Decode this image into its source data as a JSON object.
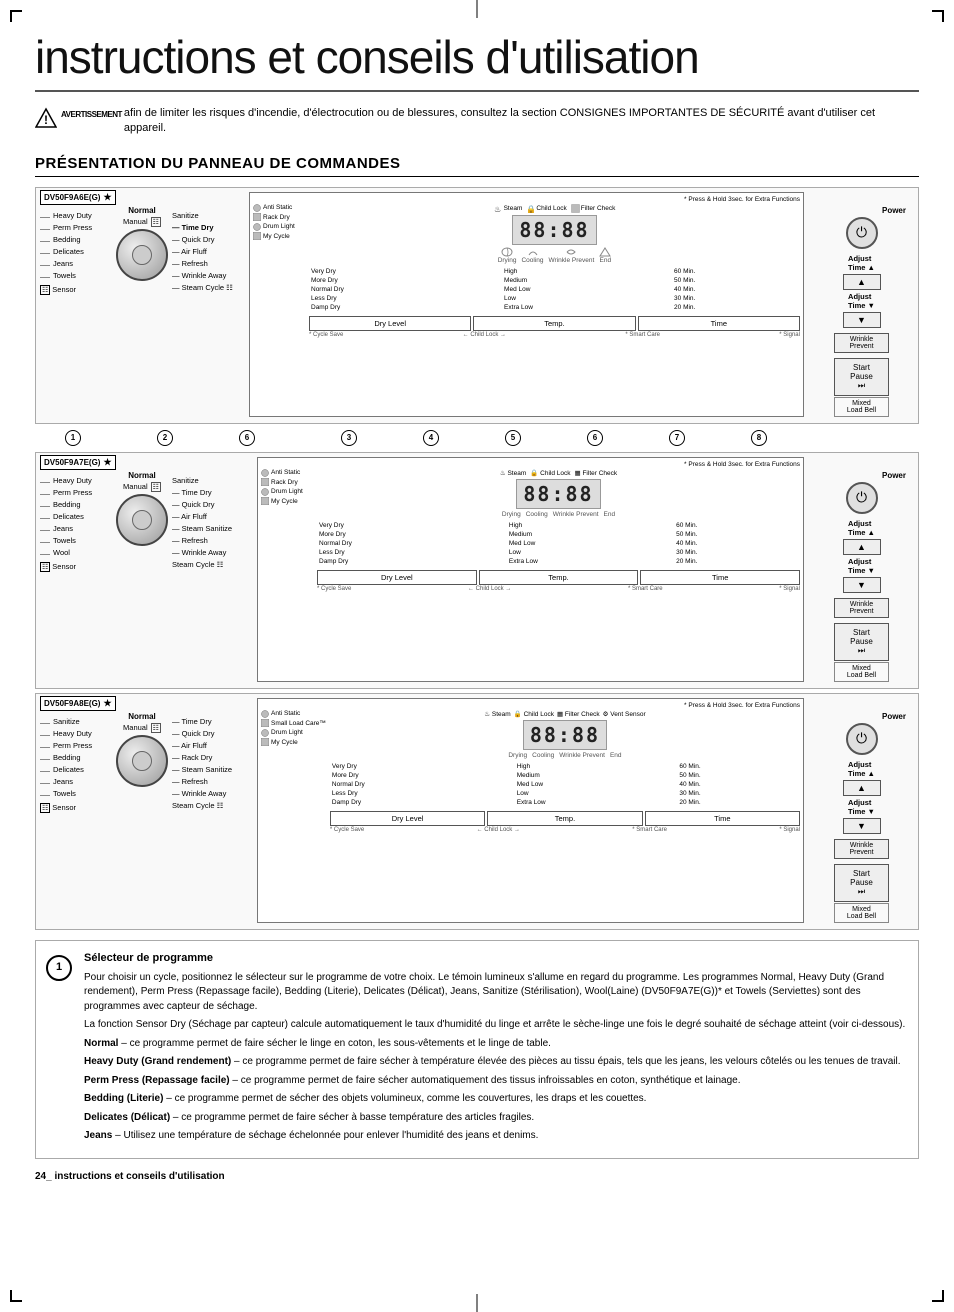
{
  "title": "instructions et conseils d'utilisation",
  "warning": {
    "text": "afin de limiter les risques d'incendie, d'électrocution ou de blessures, consultez la section CONSIGNES IMPORTANTES DE SÉCURITÉ avant d'utiliser cet appareil.",
    "label": "AVERTISSEMENT"
  },
  "section_title": "PRÉSENTATION DU PANNEAU DE COMMANDES",
  "diagrams": [
    {
      "model": "DV50F9A6E(G)",
      "star": "★",
      "left_cycles": [
        "Heavy Duty",
        "Perm Press",
        "Bedding",
        "Delicates",
        "Jeans",
        "Towels"
      ],
      "knob_label": "Normal",
      "sensor_label": "Sensor",
      "right_cycles": [
        "Sanitize",
        "Time Dry",
        "Quick Dry",
        "Air Fluff",
        "Refresh",
        "Wrinkle Away",
        "Steam Cycle"
      ],
      "manual_label": "Manual",
      "indicators": [
        "Steam",
        "Child Lock",
        "Filter Check"
      ],
      "display_digits": "88:88",
      "display_icons": [
        "Drying",
        "Cooling",
        "Wrinkle Prevent",
        "End"
      ],
      "controls_left": [
        "Anti Static",
        "Rack Dry",
        "Drum Light",
        "My Cycle"
      ],
      "options": [
        [
          "Very Dry",
          "High",
          "60 Min."
        ],
        [
          "More Dry",
          "Medium",
          "50 Min."
        ],
        [
          "Normal Dry",
          "Med Low",
          "40 Min."
        ],
        [
          "Less Dry",
          "Low",
          "30 Min."
        ],
        [
          "Damp Dry",
          "Extra Low",
          "20 Min."
        ]
      ],
      "bottom_btns": [
        "Dry Level",
        "Temp.",
        "Time"
      ],
      "bottom_labels": [
        "* Cycle Save",
        "← Child Lock →",
        "* Smart Care",
        "* Signal"
      ],
      "note": "* Press & Hold 3sec. for Extra Functions"
    },
    {
      "model": "DV50F9A7E(G)",
      "star": "★",
      "left_cycles": [
        "Heavy Duty",
        "Perm Press",
        "Bedding",
        "Delicates",
        "Jeans",
        "Towels",
        "Wool"
      ],
      "knob_label": "Normal",
      "sensor_label": "Sensor",
      "right_cycles": [
        "Sanitize",
        "Time Dry",
        "Quick Dry",
        "Air Fluff",
        "Steam Sanitize",
        "Refresh",
        "Wrinkle Away",
        "Steam Cycle"
      ],
      "manual_label": "Manual",
      "indicators": [
        "Steam",
        "Child Lock",
        "Filter Check"
      ],
      "display_digits": "88:88",
      "display_icons": [
        "Drying",
        "Cooling",
        "Wrinkle Prevent",
        "End"
      ],
      "controls_left": [
        "Anti Static",
        "Rack Dry",
        "Drum Light",
        "My Cycle"
      ],
      "options": [
        [
          "Very Dry",
          "High",
          "60 Min."
        ],
        [
          "More Dry",
          "Medium",
          "50 Min."
        ],
        [
          "Normal Dry",
          "Med Low",
          "40 Min."
        ],
        [
          "Less Dry",
          "Low",
          "30 Min."
        ],
        [
          "Damp Dry",
          "Extra Low",
          "20 Min."
        ]
      ],
      "bottom_btns": [
        "Dry Level",
        "Temp.",
        "Time"
      ],
      "bottom_labels": [
        "* Cycle Save",
        "← Child Lock →",
        "* Smart Care",
        "* Signal"
      ],
      "note": "* Press & Hold 3sec. for Extra Functions"
    },
    {
      "model": "DV50F9A8E(G)",
      "star": "★",
      "left_cycles": [
        "Sanitize",
        "Heavy Duty",
        "Perm Press",
        "Bedding",
        "Delicates",
        "Jeans",
        "Towels"
      ],
      "knob_label": "Normal",
      "sensor_label": "Sensor",
      "right_cycles": [
        "Time Dry",
        "Quick Dry",
        "Air Fluff",
        "Rack Dry",
        "Steam Sanitize",
        "Refresh",
        "Wrinkle Away",
        "Steam Cycle"
      ],
      "manual_label": "Manual",
      "indicators": [
        "Steam",
        "Child Lock",
        "Filter Check",
        "Vent Sensor"
      ],
      "display_digits": "88:88",
      "display_icons": [
        "Drying",
        "Cooling",
        "Wrinkle Prevent",
        "End"
      ],
      "controls_left": [
        "Anti Static",
        "Small Load Care™",
        "Drum Light",
        "My Cycle"
      ],
      "options": [
        [
          "Very Dry",
          "High",
          "60 Min."
        ],
        [
          "More Dry",
          "Medium",
          "50 Min."
        ],
        [
          "Normal Dry",
          "Med Low",
          "40 Min."
        ],
        [
          "Less Dry",
          "Low",
          "30 Min."
        ],
        [
          "Damp Dry",
          "Extra Low",
          "20 Min."
        ]
      ],
      "bottom_btns": [
        "Dry Level",
        "Temp.",
        "Time"
      ],
      "bottom_labels": [
        "* Cycle Save",
        "← Child Lock →",
        "* Smart Care",
        "* Signal"
      ],
      "note": "* Press & Hold 3sec. for Extra Functions"
    }
  ],
  "numbering": [
    "1",
    "2",
    "6",
    "3",
    "4",
    "5",
    "6",
    "7",
    "8"
  ],
  "description": {
    "number": "1",
    "title": "Sélecteur de programme",
    "paragraphs": [
      "Pour choisir un cycle, positionnez le sélecteur sur le programme de votre choix. Le témoin lumineux s'allume en regard du programme. Les programmes Normal, Heavy Duty (Grand rendement), Perm Press (Repassage facile), Bedding (Literie), Delicates (Délicat), Jeans, Sanitize (Stérilisation), Wool(Laine) (DV50F9A7E(G))* et Towels (Serviettes) sont des programmes avec capteur de séchage.",
      "La fonction Sensor Dry (Séchage par capteur) calcule automatiquement le taux d'humidité du linge et arrête le sèche-linge une fois le degré souhaité de séchage atteint (voir ci-dessous).",
      "Normal – ce programme permet de faire sécher le linge en coton, les sous-vêtements et le linge de table.",
      "Heavy Duty (Grand rendement) – ce programme permet de faire sécher à température élevée des pièces au tissu épais, tels que les jeans, les velours côtelés ou les tenues de travail.",
      "Perm Press (Repassage facile) – ce programme permet de faire sécher automatiquement des tissus infroissables en coton, synthétique et lainage.",
      "Bedding (Literie)  – ce programme permet de sécher des objets volumineux, comme les couvertures, les draps et les couettes.",
      "Delicates (Délicat) – ce programme permet de faire sécher à basse température des articles fragiles.",
      "Jeans – Utilisez une température de séchage échelonnée pour enlever l'humidité des jeans et denims."
    ]
  },
  "footer": "24_ instructions et conseils d'utilisation"
}
